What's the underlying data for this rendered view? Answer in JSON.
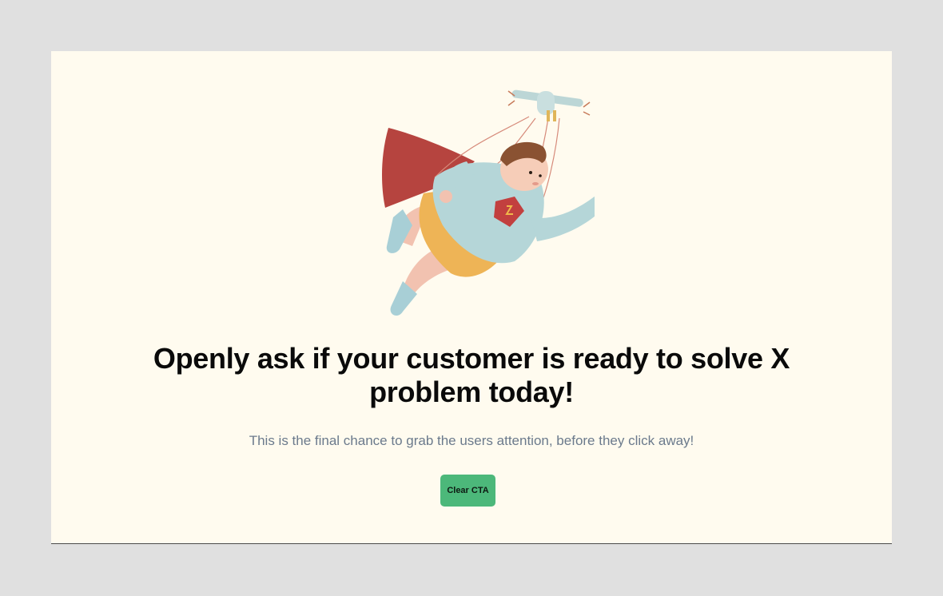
{
  "hero": {
    "illustration_icon": "flying-superhero-kid-icon",
    "headline_line1": "Openly ask if your customer is ready to solve X",
    "headline_line2": "problem today!",
    "subtitle": "This is the final chance to grab the users attention, before they click away!",
    "cta_label": "Clear CTA"
  },
  "colors": {
    "page_background": "#e0e0e0",
    "card_background": "#fffbef",
    "headline": "#0a0a0a",
    "subtitle": "#6b7a8c",
    "cta_background": "#4cb87a"
  }
}
